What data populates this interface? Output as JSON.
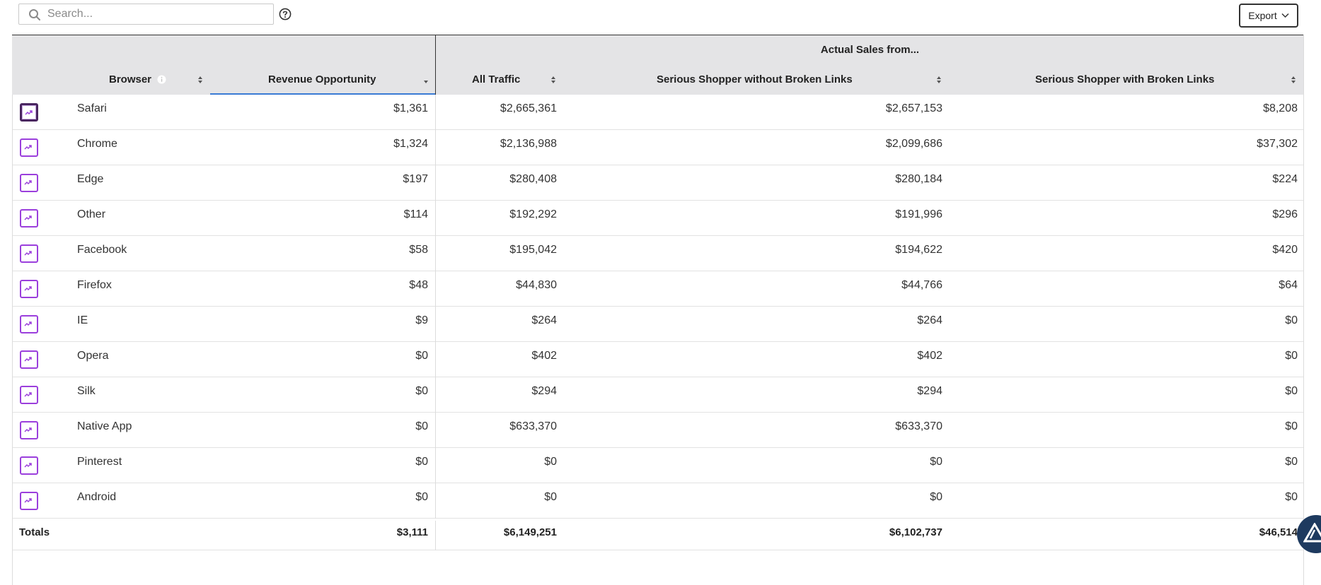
{
  "search": {
    "placeholder": "Search...",
    "value": ""
  },
  "export": {
    "label": "Export"
  },
  "table": {
    "group_header": "Actual Sales from...",
    "columns": {
      "browser": "Browser",
      "revenue": "Revenue Opportunity",
      "all_traffic": "All Traffic",
      "ss_without": "Serious Shopper without Broken Links",
      "ss_with": "Serious Shopper with Broken Links"
    },
    "rows": [
      {
        "browser": "Safari",
        "revenue": "$1,361",
        "all_traffic": "$2,665,361",
        "ss_without": "$2,657,153",
        "ss_with": "$8,208"
      },
      {
        "browser": "Chrome",
        "revenue": "$1,324",
        "all_traffic": "$2,136,988",
        "ss_without": "$2,099,686",
        "ss_with": "$37,302"
      },
      {
        "browser": "Edge",
        "revenue": "$197",
        "all_traffic": "$280,408",
        "ss_without": "$280,184",
        "ss_with": "$224"
      },
      {
        "browser": "Other",
        "revenue": "$114",
        "all_traffic": "$192,292",
        "ss_without": "$191,996",
        "ss_with": "$296"
      },
      {
        "browser": "Facebook",
        "revenue": "$58",
        "all_traffic": "$195,042",
        "ss_without": "$194,622",
        "ss_with": "$420"
      },
      {
        "browser": "Firefox",
        "revenue": "$48",
        "all_traffic": "$44,830",
        "ss_without": "$44,766",
        "ss_with": "$64"
      },
      {
        "browser": "IE",
        "revenue": "$9",
        "all_traffic": "$264",
        "ss_without": "$264",
        "ss_with": "$0"
      },
      {
        "browser": "Opera",
        "revenue": "$0",
        "all_traffic": "$402",
        "ss_without": "$402",
        "ss_with": "$0"
      },
      {
        "browser": "Silk",
        "revenue": "$0",
        "all_traffic": "$294",
        "ss_without": "$294",
        "ss_with": "$0"
      },
      {
        "browser": "Native App",
        "revenue": "$0",
        "all_traffic": "$633,370",
        "ss_without": "$633,370",
        "ss_with": "$0"
      },
      {
        "browser": "Pinterest",
        "revenue": "$0",
        "all_traffic": "$0",
        "ss_without": "$0",
        "ss_with": "$0"
      },
      {
        "browser": "Android",
        "revenue": "$0",
        "all_traffic": "$0",
        "ss_without": "$0",
        "ss_with": "$0"
      }
    ],
    "totals": {
      "label": "Totals",
      "revenue": "$3,111",
      "all_traffic": "$6,149,251",
      "ss_without": "$6,102,737",
      "ss_with": "$46,514"
    }
  },
  "colors": {
    "header_bg": "#e4e4e6",
    "trend_accent": "#9b3fdc",
    "active_sort": "#3a7bd5"
  }
}
